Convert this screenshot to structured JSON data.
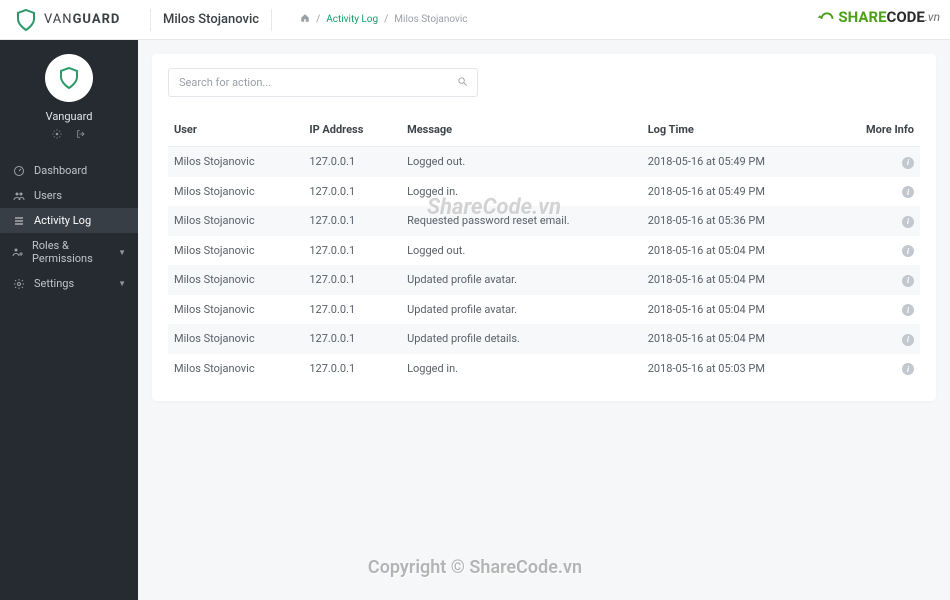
{
  "brand": {
    "left": "VAN",
    "right": "GUARD"
  },
  "page_title": "Milos Stojanovic",
  "breadcrumb": {
    "link": "Activity Log",
    "current": "Milos Stojanovic"
  },
  "sidebar": {
    "username": "Vanguard",
    "items": [
      {
        "label": "Dashboard",
        "icon": "dashboard"
      },
      {
        "label": "Users",
        "icon": "users"
      },
      {
        "label": "Activity Log",
        "icon": "list",
        "active": true
      },
      {
        "label": "Roles & Permissions",
        "icon": "roles",
        "caret": true
      },
      {
        "label": "Settings",
        "icon": "gear",
        "caret": true
      }
    ]
  },
  "search": {
    "placeholder": "Search for action..."
  },
  "table": {
    "headers": {
      "user": "User",
      "ip": "IP Address",
      "message": "Message",
      "log_time": "Log Time",
      "more": "More Info"
    },
    "rows": [
      {
        "user": "Milos Stojanovic",
        "ip": "127.0.0.1",
        "message": "Logged out.",
        "log_time": "2018-05-16 at 05:49 PM"
      },
      {
        "user": "Milos Stojanovic",
        "ip": "127.0.0.1",
        "message": "Logged in.",
        "log_time": "2018-05-16 at 05:49 PM"
      },
      {
        "user": "Milos Stojanovic",
        "ip": "127.0.0.1",
        "message": "Requested password reset email.",
        "log_time": "2018-05-16 at 05:36 PM"
      },
      {
        "user": "Milos Stojanovic",
        "ip": "127.0.0.1",
        "message": "Logged out.",
        "log_time": "2018-05-16 at 05:04 PM"
      },
      {
        "user": "Milos Stojanovic",
        "ip": "127.0.0.1",
        "message": "Updated profile avatar.",
        "log_time": "2018-05-16 at 05:04 PM"
      },
      {
        "user": "Milos Stojanovic",
        "ip": "127.0.0.1",
        "message": "Updated profile avatar.",
        "log_time": "2018-05-16 at 05:04 PM"
      },
      {
        "user": "Milos Stojanovic",
        "ip": "127.0.0.1",
        "message": "Updated profile details.",
        "log_time": "2018-05-16 at 05:04 PM"
      },
      {
        "user": "Milos Stojanovic",
        "ip": "127.0.0.1",
        "message": "Logged in.",
        "log_time": "2018-05-16 at 05:03 PM"
      }
    ]
  },
  "watermark": {
    "center": "ShareCode.vn",
    "bottom": "Copyright © ShareCode.vn"
  },
  "sharecode": {
    "share": "SHARE",
    "code": "CODE",
    "vn": ".vn"
  }
}
